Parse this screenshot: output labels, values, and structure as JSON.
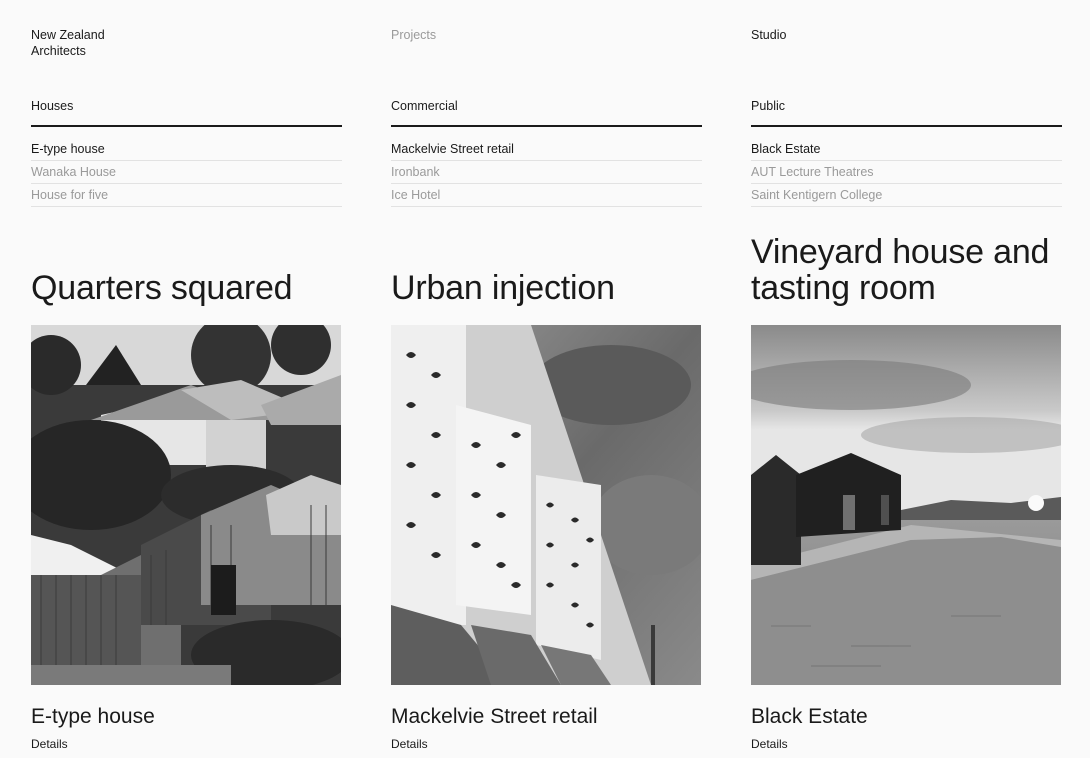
{
  "nav": {
    "brand": "New Zealand Architects",
    "brand_line1": "New Zealand",
    "brand_line2": "Architects",
    "projects": "Projects",
    "studio": "Studio"
  },
  "categories": [
    {
      "label": "Houses",
      "items": [
        {
          "label": "E-type house",
          "current": true
        },
        {
          "label": "Wanaka House",
          "current": false
        },
        {
          "label": "House for five",
          "current": false
        }
      ],
      "feature_title": "Quarters squared",
      "caption": "E-type house",
      "details": "Details"
    },
    {
      "label": "Commercial",
      "items": [
        {
          "label": "Mackelvie Street retail",
          "current": true
        },
        {
          "label": "Ironbank",
          "current": false
        },
        {
          "label": "Ice Hotel",
          "current": false
        }
      ],
      "feature_title": "Urban injection",
      "caption": "Mackelvie Street retail",
      "details": "Details"
    },
    {
      "label": "Public",
      "items": [
        {
          "label": "Black Estate",
          "current": true
        },
        {
          "label": "AUT Lecture Theatres",
          "current": false
        },
        {
          "label": "Saint Kentigern College",
          "current": false
        }
      ],
      "feature_title": "Vineyard house and tasting room",
      "caption": "Black Estate",
      "details": "Details"
    }
  ],
  "colors": {
    "text": "#1a1a1a",
    "muted": "#9a9a9a",
    "background": "#fafafa",
    "rule": "#e2e2e2"
  }
}
